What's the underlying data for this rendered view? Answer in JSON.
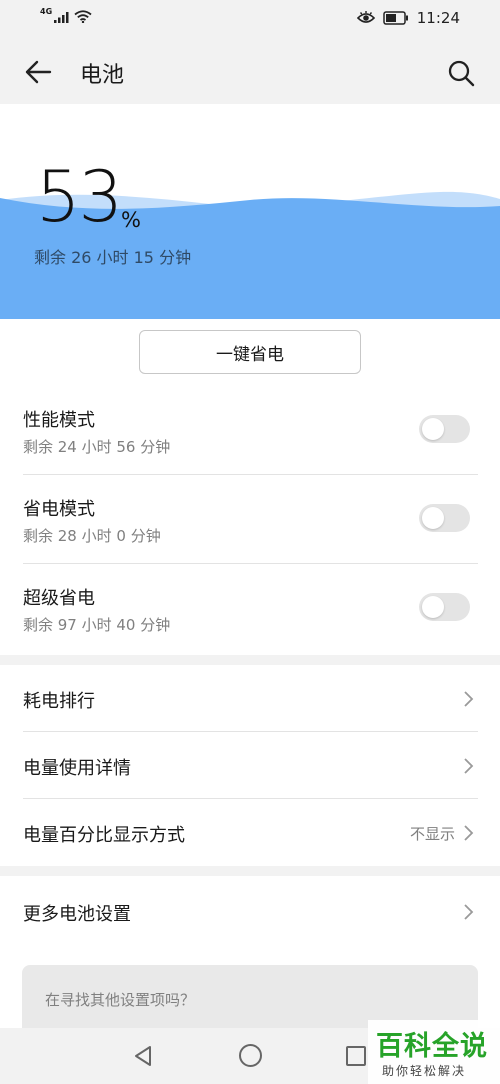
{
  "status_bar": {
    "network_label": "4G",
    "time": "11:24",
    "icons": [
      "signal-icon",
      "wifi-icon",
      "eye-icon",
      "battery-icon"
    ]
  },
  "header": {
    "title": "电池",
    "back_icon": "arrow-left-icon",
    "search_icon": "search-icon"
  },
  "battery": {
    "percent": "53",
    "percent_sign": "%",
    "remaining": "剩余 26 小时 15 分钟",
    "level": 0.53,
    "wave_color": "#6aaef5"
  },
  "one_key_saver": {
    "label": "一键省电"
  },
  "modes": [
    {
      "title": "性能模式",
      "remaining": "剩余 24 小时 56 分钟",
      "enabled": false
    },
    {
      "title": "省电模式",
      "remaining": "剩余 28 小时 0 分钟",
      "enabled": false
    },
    {
      "title": "超级省电",
      "remaining": "剩余 97 小时 40 分钟",
      "enabled": false
    }
  ],
  "nav_items": [
    {
      "label": "耗电排行",
      "value": ""
    },
    {
      "label": "电量使用详情",
      "value": ""
    },
    {
      "label": "电量百分比显示方式",
      "value": "不显示"
    }
  ],
  "more_settings": {
    "label": "更多电池设置"
  },
  "search_suggestion": {
    "text": "在寻找其他设置项吗？"
  },
  "system_nav": {
    "icons": [
      "back-triangle-icon",
      "home-circle-icon",
      "recent-square-icon"
    ]
  },
  "watermark": {
    "title": "百科全说",
    "subtitle": "助你轻松解决"
  },
  "colors": {
    "background": "#f2f2f2",
    "card": "#ffffff",
    "wave": "#6aaef5",
    "toggle_off": "#e4e4e4",
    "watermark_green": "#27a329"
  }
}
